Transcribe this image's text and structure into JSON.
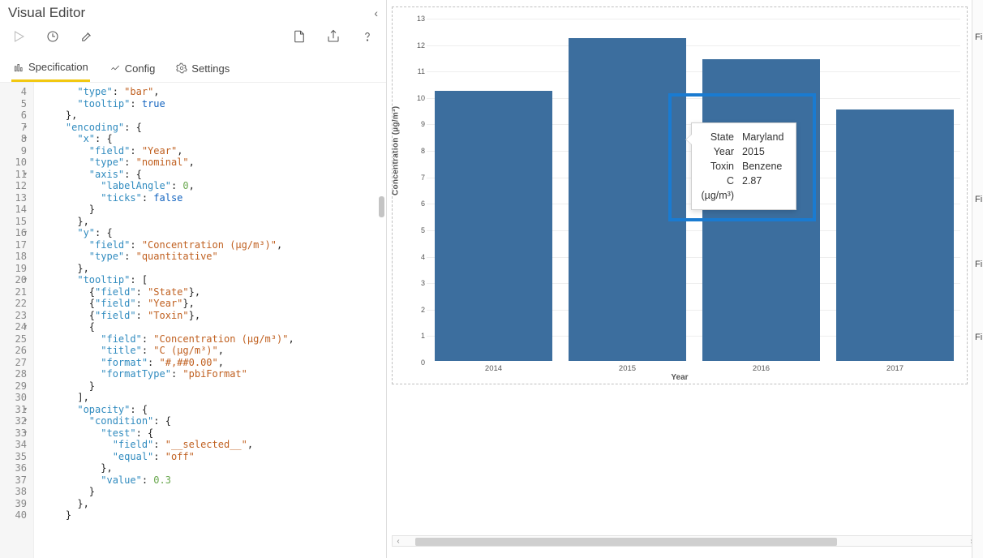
{
  "editor": {
    "title": "Visual Editor",
    "tabs": {
      "specification": "Specification",
      "config": "Config",
      "settings": "Settings"
    }
  },
  "code": {
    "lines": [
      {
        "n": 4,
        "indent": 6,
        "tokens": [
          [
            "key",
            "\"type\""
          ],
          [
            "pun",
            ": "
          ],
          [
            "str",
            "\"bar\""
          ],
          [
            "pun",
            ","
          ]
        ]
      },
      {
        "n": 5,
        "indent": 6,
        "tokens": [
          [
            "key",
            "\"tooltip\""
          ],
          [
            "pun",
            ": "
          ],
          [
            "kw",
            "true"
          ]
        ]
      },
      {
        "n": 6,
        "indent": 4,
        "tokens": [
          [
            "pun",
            "},"
          ]
        ]
      },
      {
        "n": 7,
        "fold": true,
        "indent": 4,
        "tokens": [
          [
            "key",
            "\"encoding\""
          ],
          [
            "pun",
            ": {"
          ]
        ]
      },
      {
        "n": 8,
        "fold": true,
        "indent": 6,
        "tokens": [
          [
            "key",
            "\"x\""
          ],
          [
            "pun",
            ": {"
          ]
        ]
      },
      {
        "n": 9,
        "indent": 8,
        "tokens": [
          [
            "key",
            "\"field\""
          ],
          [
            "pun",
            ": "
          ],
          [
            "str",
            "\"Year\""
          ],
          [
            "pun",
            ","
          ]
        ]
      },
      {
        "n": 10,
        "indent": 8,
        "tokens": [
          [
            "key",
            "\"type\""
          ],
          [
            "pun",
            ": "
          ],
          [
            "str",
            "\"nominal\""
          ],
          [
            "pun",
            ","
          ]
        ]
      },
      {
        "n": 11,
        "fold": true,
        "indent": 8,
        "tokens": [
          [
            "key",
            "\"axis\""
          ],
          [
            "pun",
            ": {"
          ]
        ]
      },
      {
        "n": 12,
        "indent": 10,
        "tokens": [
          [
            "key",
            "\"labelAngle\""
          ],
          [
            "pun",
            ": "
          ],
          [
            "num",
            "0"
          ],
          [
            "pun",
            ","
          ]
        ]
      },
      {
        "n": 13,
        "indent": 10,
        "tokens": [
          [
            "key",
            "\"ticks\""
          ],
          [
            "pun",
            ": "
          ],
          [
            "kw",
            "false"
          ]
        ]
      },
      {
        "n": 14,
        "indent": 8,
        "tokens": [
          [
            "pun",
            "}"
          ]
        ]
      },
      {
        "n": 15,
        "indent": 6,
        "tokens": [
          [
            "pun",
            "},"
          ]
        ]
      },
      {
        "n": 16,
        "fold": true,
        "indent": 6,
        "tokens": [
          [
            "key",
            "\"y\""
          ],
          [
            "pun",
            ": {"
          ]
        ]
      },
      {
        "n": 17,
        "indent": 8,
        "tokens": [
          [
            "key",
            "\"field\""
          ],
          [
            "pun",
            ": "
          ],
          [
            "str",
            "\"Concentration (µg/m³)\""
          ],
          [
            "pun",
            ","
          ]
        ]
      },
      {
        "n": 18,
        "indent": 8,
        "tokens": [
          [
            "key",
            "\"type\""
          ],
          [
            "pun",
            ": "
          ],
          [
            "str",
            "\"quantitative\""
          ]
        ]
      },
      {
        "n": 19,
        "indent": 6,
        "tokens": [
          [
            "pun",
            "},"
          ]
        ]
      },
      {
        "n": 20,
        "fold": true,
        "indent": 6,
        "tokens": [
          [
            "key",
            "\"tooltip\""
          ],
          [
            "pun",
            ": ["
          ]
        ]
      },
      {
        "n": 21,
        "indent": 8,
        "tokens": [
          [
            "pun",
            "{"
          ],
          [
            "key",
            "\"field\""
          ],
          [
            "pun",
            ": "
          ],
          [
            "str",
            "\"State\""
          ],
          [
            "pun",
            "},"
          ]
        ]
      },
      {
        "n": 22,
        "indent": 8,
        "tokens": [
          [
            "pun",
            "{"
          ],
          [
            "key",
            "\"field\""
          ],
          [
            "pun",
            ": "
          ],
          [
            "str",
            "\"Year\""
          ],
          [
            "pun",
            "},"
          ]
        ]
      },
      {
        "n": 23,
        "indent": 8,
        "tokens": [
          [
            "pun",
            "{"
          ],
          [
            "key",
            "\"field\""
          ],
          [
            "pun",
            ": "
          ],
          [
            "str",
            "\"Toxin\""
          ],
          [
            "pun",
            "},"
          ]
        ]
      },
      {
        "n": 24,
        "fold": true,
        "indent": 8,
        "tokens": [
          [
            "pun",
            "{"
          ]
        ]
      },
      {
        "n": 25,
        "indent": 10,
        "tokens": [
          [
            "key",
            "\"field\""
          ],
          [
            "pun",
            ": "
          ],
          [
            "str",
            "\"Concentration (µg/m³)\""
          ],
          [
            "pun",
            ","
          ]
        ]
      },
      {
        "n": 26,
        "indent": 10,
        "tokens": [
          [
            "key",
            "\"title\""
          ],
          [
            "pun",
            ": "
          ],
          [
            "str",
            "\"C (µg/m³)\""
          ],
          [
            "pun",
            ","
          ]
        ]
      },
      {
        "n": 27,
        "indent": 10,
        "tokens": [
          [
            "key",
            "\"format\""
          ],
          [
            "pun",
            ": "
          ],
          [
            "str",
            "\"#,##0.00\""
          ],
          [
            "pun",
            ","
          ]
        ]
      },
      {
        "n": 28,
        "indent": 10,
        "tokens": [
          [
            "key",
            "\"formatType\""
          ],
          [
            "pun",
            ": "
          ],
          [
            "str",
            "\"pbiFormat\""
          ]
        ]
      },
      {
        "n": 29,
        "indent": 8,
        "tokens": [
          [
            "pun",
            "}"
          ]
        ]
      },
      {
        "n": 30,
        "indent": 6,
        "tokens": [
          [
            "pun",
            "],"
          ]
        ]
      },
      {
        "n": 31,
        "fold": true,
        "indent": 6,
        "tokens": [
          [
            "key",
            "\"opacity\""
          ],
          [
            "pun",
            ": {"
          ]
        ]
      },
      {
        "n": 32,
        "fold": true,
        "indent": 8,
        "tokens": [
          [
            "key",
            "\"condition\""
          ],
          [
            "pun",
            ": {"
          ]
        ]
      },
      {
        "n": 33,
        "fold": true,
        "indent": 10,
        "tokens": [
          [
            "key",
            "\"test\""
          ],
          [
            "pun",
            ": {"
          ]
        ]
      },
      {
        "n": 34,
        "indent": 12,
        "tokens": [
          [
            "key",
            "\"field\""
          ],
          [
            "pun",
            ": "
          ],
          [
            "str",
            "\"__selected__\""
          ],
          [
            "pun",
            ","
          ]
        ]
      },
      {
        "n": 35,
        "indent": 12,
        "tokens": [
          [
            "key",
            "\"equal\""
          ],
          [
            "pun",
            ": "
          ],
          [
            "str",
            "\"off\""
          ]
        ]
      },
      {
        "n": 36,
        "indent": 10,
        "tokens": [
          [
            "pun",
            "},"
          ]
        ]
      },
      {
        "n": 37,
        "indent": 10,
        "tokens": [
          [
            "key",
            "\"value\""
          ],
          [
            "pun",
            ": "
          ],
          [
            "num",
            "0.3"
          ]
        ]
      },
      {
        "n": 38,
        "indent": 8,
        "tokens": [
          [
            "pun",
            "}"
          ]
        ]
      },
      {
        "n": 39,
        "indent": 6,
        "tokens": [
          [
            "pun",
            "},"
          ]
        ]
      },
      {
        "n": 40,
        "indent": 4,
        "tokens": [
          [
            "pun",
            "}"
          ]
        ]
      }
    ]
  },
  "tooltip": {
    "rows": [
      {
        "label": "State",
        "value": "Maryland"
      },
      {
        "label": "Year",
        "value": "2015"
      },
      {
        "label": "Toxin",
        "value": "Benzene"
      },
      {
        "label": "C (µg/m³)",
        "value": "2.87"
      }
    ]
  },
  "sidePanel": {
    "labels": [
      "Fi",
      "Fi",
      "Fi",
      "Fi"
    ]
  },
  "chart_data": {
    "type": "bar",
    "categories": [
      "2014",
      "2015",
      "2016",
      "2017"
    ],
    "values": [
      10.2,
      12.2,
      11.4,
      9.5
    ],
    "title": "",
    "xlabel": "Year",
    "ylabel": "Concentration (µg/m³)",
    "ylim": [
      0,
      13
    ],
    "yticks": [
      0,
      1,
      2,
      3,
      4,
      5,
      6,
      7,
      8,
      9,
      10,
      11,
      12,
      13
    ]
  }
}
